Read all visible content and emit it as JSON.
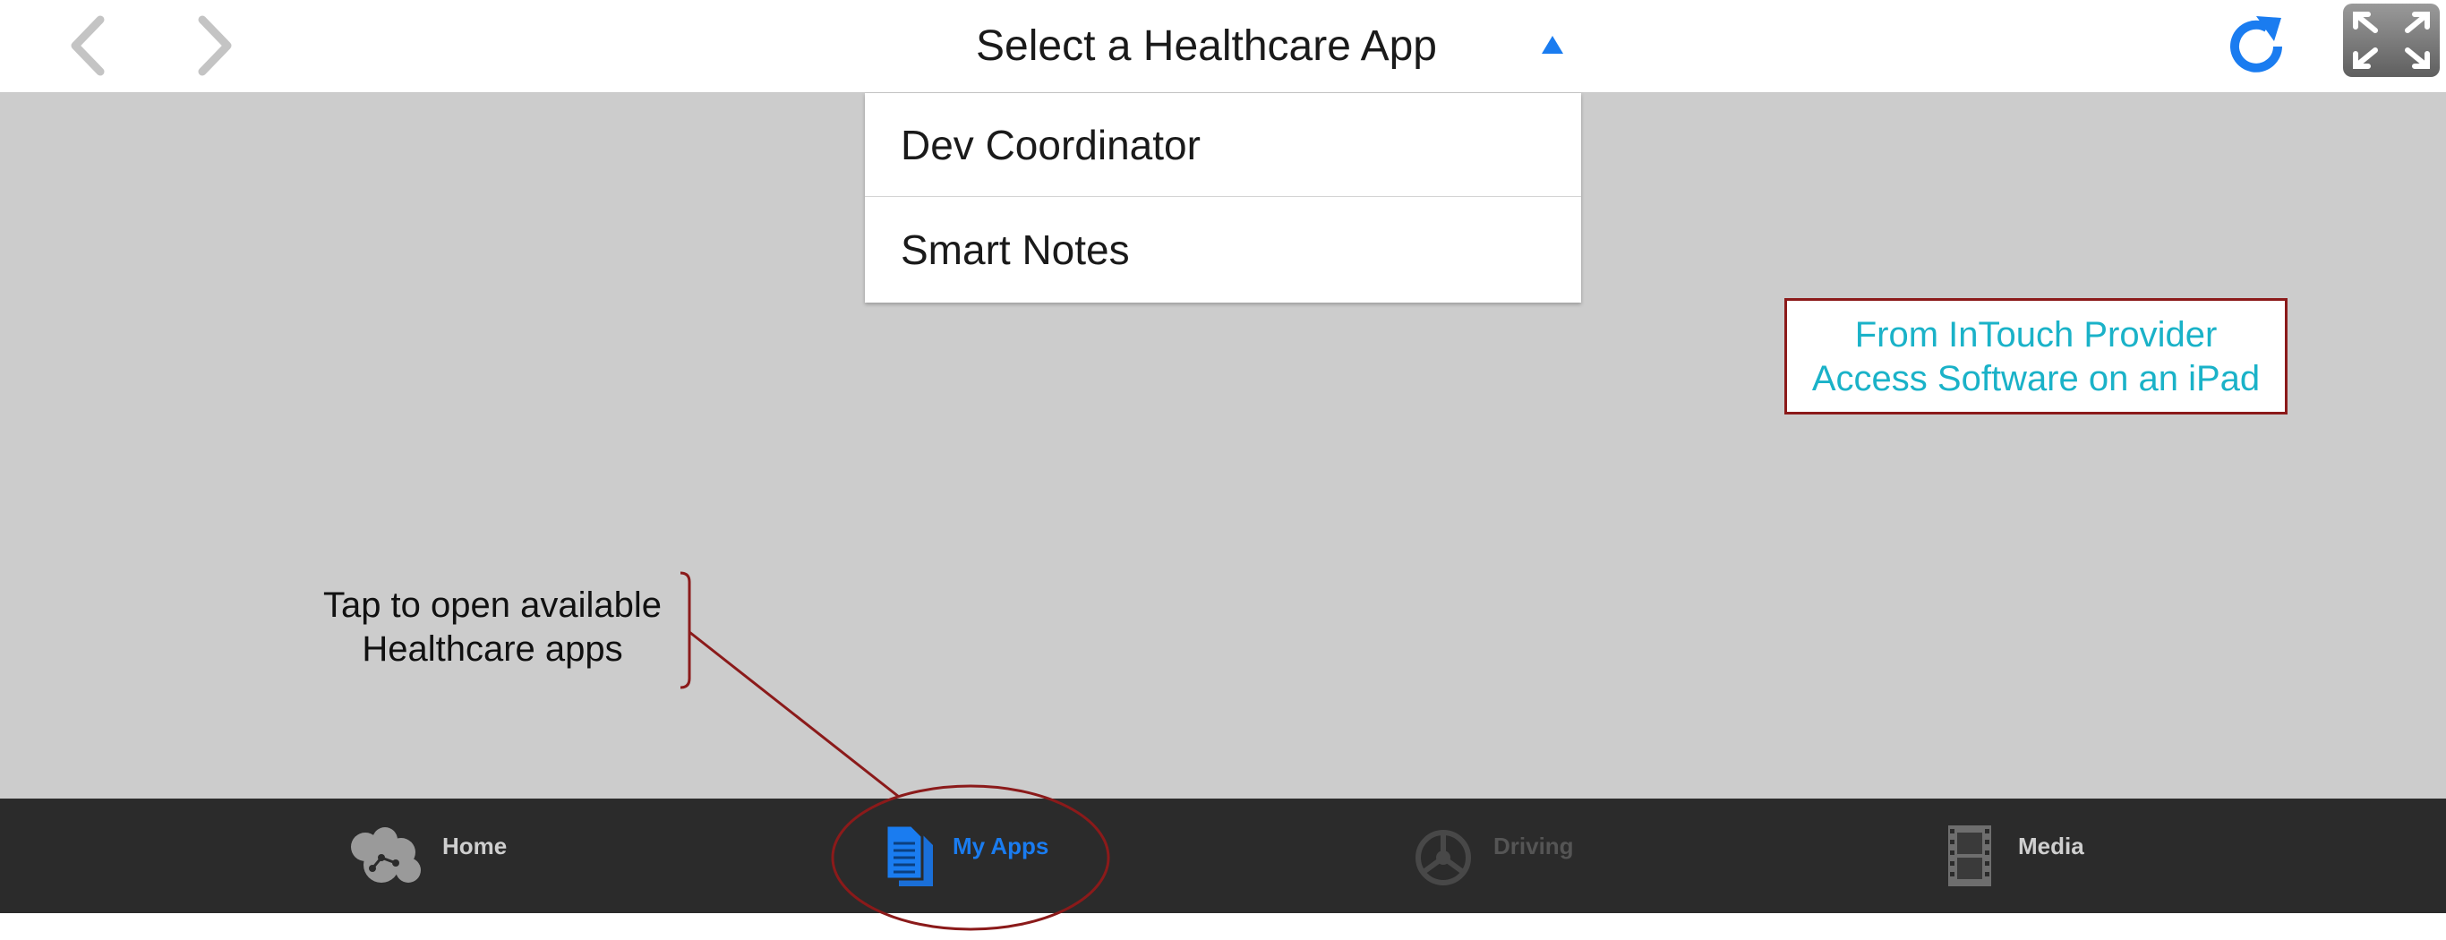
{
  "header": {
    "title": "Select a Healthcare App",
    "back_icon": "chevron-left-icon",
    "forward_icon": "chevron-right-icon",
    "dropdown_caret_icon": "caret-up-icon",
    "refresh_icon": "refresh-icon",
    "expand_icon": "fullscreen-expand-icon"
  },
  "dropdown": {
    "items": [
      {
        "label": "Dev Coordinator"
      },
      {
        "label": "Smart Notes"
      }
    ]
  },
  "callout": {
    "line1": "From InTouch Provider",
    "line2": "Access Software on an iPad"
  },
  "annotation": {
    "line1": "Tap to open available",
    "line2": "Healthcare apps"
  },
  "tabbar": {
    "tabs": [
      {
        "label": "Home",
        "icon": "home-network-icon",
        "state": "normal"
      },
      {
        "label": "My Apps",
        "icon": "documents-icon",
        "state": "selected"
      },
      {
        "label": "Driving",
        "icon": "steering-wheel-icon",
        "state": "disabled"
      },
      {
        "label": "Media",
        "icon": "film-strip-icon",
        "state": "normal"
      }
    ]
  },
  "colors": {
    "accent_blue": "#1a7cf0",
    "callout_text": "#1ab2c8",
    "annotation_red": "#8b1a1a",
    "content_bg": "#cccccc",
    "tabbar_bg": "#2b2b2b"
  }
}
